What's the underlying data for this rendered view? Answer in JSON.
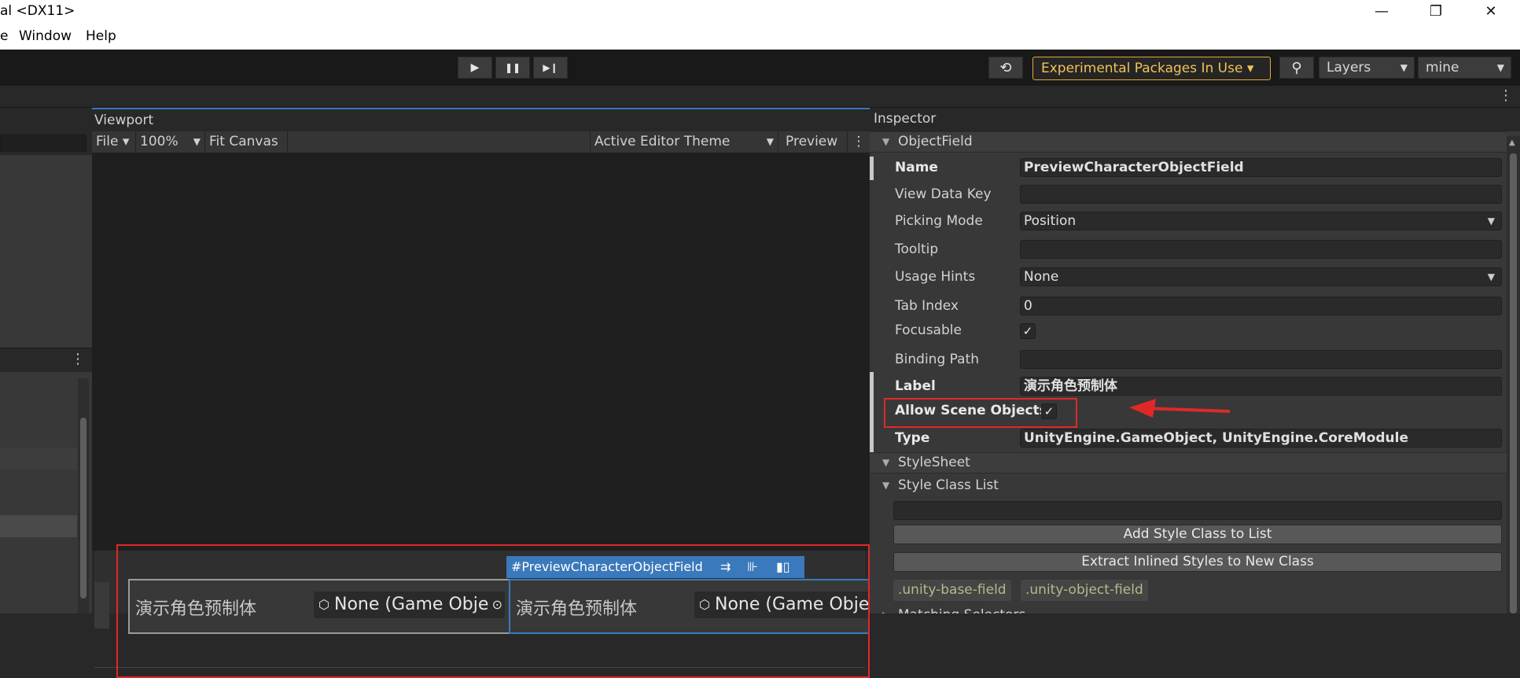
{
  "window": {
    "title": "al <DX11>",
    "minimize": "—",
    "maximize": "❐",
    "close": "✕"
  },
  "menu": {
    "items": [
      "e",
      "Window",
      "Help"
    ]
  },
  "toolbar": {
    "play": "▶",
    "pause": "❚❚",
    "step": "▶❙",
    "history": "⟲",
    "experimental": "Experimental Packages In Use ▾",
    "search": "⚲",
    "layers": "Layers",
    "layout": "mine",
    "kebab": "⋮"
  },
  "viewport": {
    "title": "Viewport",
    "file": "File ▾",
    "zoom": "100%",
    "fit": "Fit Canvas",
    "theme": "Active Editor Theme",
    "preview": "Preview",
    "kebab": "⋮",
    "label1": "演示角色预制体",
    "value1": "None (Game Obje",
    "label2": "演示角色预制体",
    "value2": "None (Game Obje",
    "selection_tag": "#PreviewCharacterObjectField"
  },
  "inspector": {
    "title": "Inspector",
    "section1": "ObjectField",
    "rows": [
      {
        "label": "Name",
        "value": "PreviewCharacterObjectField"
      },
      {
        "label": "View Data Key",
        "value": ""
      },
      {
        "label": "Picking Mode",
        "value": "Position"
      },
      {
        "label": "Tooltip",
        "value": ""
      },
      {
        "label": "Usage Hints",
        "value": "None"
      },
      {
        "label": "Tab Index",
        "value": "0"
      },
      {
        "label": "Focusable",
        "value": "✓"
      },
      {
        "label": "Binding Path",
        "value": ""
      },
      {
        "label": "Label",
        "value": "演示角色预制体"
      },
      {
        "label": "Allow Scene Objects",
        "value": "✓"
      },
      {
        "label": "Type",
        "value": "UnityEngine.GameObject, UnityEngine.CoreModule"
      }
    ],
    "section2": "StyleSheet",
    "section3": "Style Class List",
    "add_btn": "Add Style Class to List",
    "extract_btn": "Extract Inlined Styles to New Class",
    "tags": [
      ".unity-base-field",
      ".unity-object-field"
    ],
    "section4": "Matching Selectors"
  },
  "colors": {
    "accent": "#3a79bb",
    "highlight": "#e02828",
    "experimental": "#e8a733"
  }
}
